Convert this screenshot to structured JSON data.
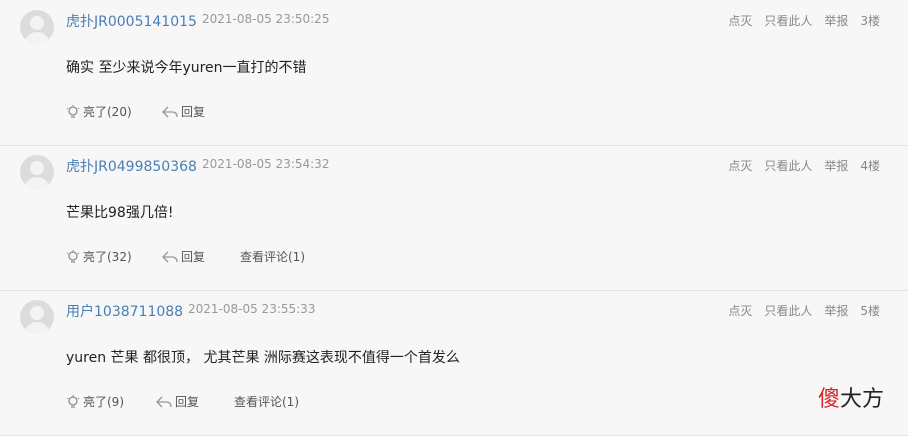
{
  "posts": [
    {
      "username": "虎扑JR0005141015",
      "time": "2021-08-05 23:50:25",
      "ops": [
        "点灭",
        "只看此人",
        "举报"
      ],
      "floor": "3楼",
      "content": "确实 至少来说今年yuren一直打的不错",
      "like": "亮了(20)",
      "reply": "回复"
    },
    {
      "username": "虎扑JR0499850368",
      "time": "2021-08-05 23:54:32",
      "ops": [
        "点灭",
        "只看此人",
        "举报"
      ],
      "floor": "4楼",
      "content": "芒果比98强几倍!",
      "like": "亮了(32)",
      "reply": "回复",
      "view_comments": "查看评论(1)"
    },
    {
      "username": "用户1038711088",
      "time": "2021-08-05 23:55:33",
      "ops": [
        "点灭",
        "只看此人",
        "举报"
      ],
      "floor": "5楼",
      "content": "yuren 芒果 都很顶， 尤其芒果 洲际赛这表现不值得一个首发么",
      "like": "亮了(9)",
      "reply": "回复",
      "view_comments": "查看评论(1)"
    }
  ],
  "watermark": {
    "red": "傻",
    "black": "大方"
  }
}
